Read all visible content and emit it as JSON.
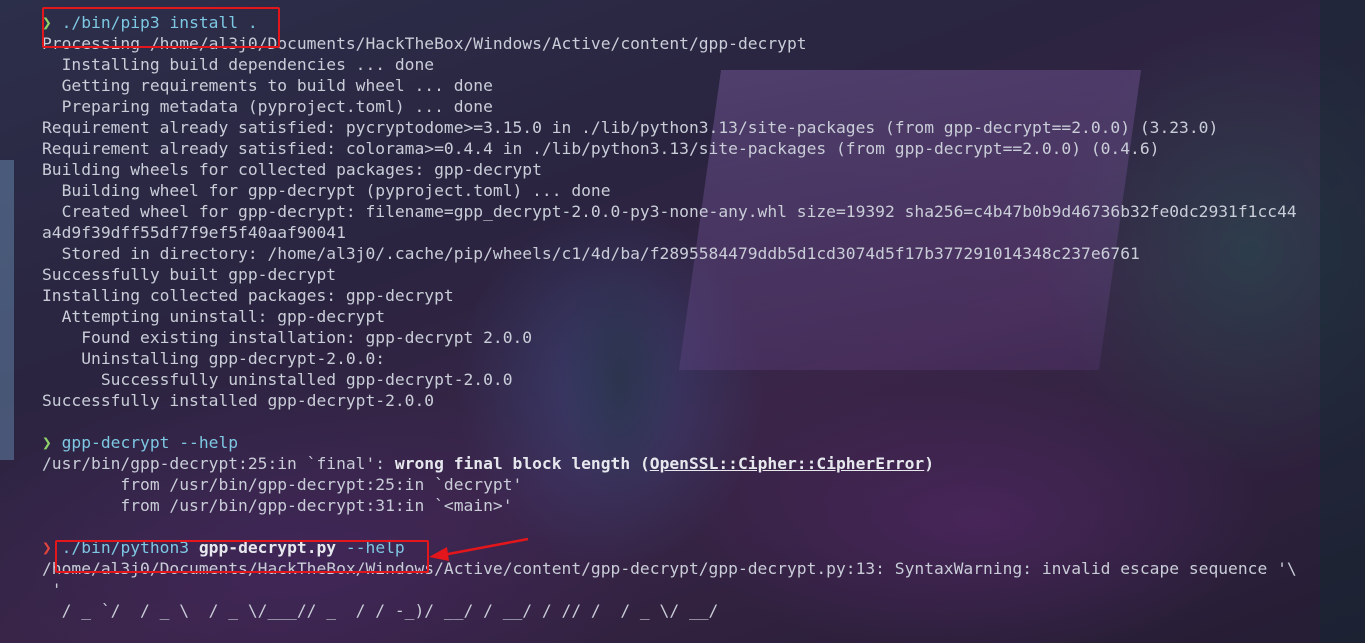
{
  "terminal": {
    "prompt_symbol": "❯",
    "lines": [
      {
        "kind": "prompt",
        "cmd": "./bin/pip3",
        "args": " install ."
      },
      {
        "kind": "text",
        "text": "Processing /home/al3j0/Documents/HackTheBox/Windows/Active/content/gpp-decrypt"
      },
      {
        "kind": "text",
        "text": "  Installing build dependencies ... done"
      },
      {
        "kind": "text",
        "text": "  Getting requirements to build wheel ... done"
      },
      {
        "kind": "text",
        "text": "  Preparing metadata (pyproject.toml) ... done"
      },
      {
        "kind": "text",
        "text": "Requirement already satisfied: pycryptodome>=3.15.0 in ./lib/python3.13/site-packages (from gpp-decrypt==2.0.0) (3.23.0)"
      },
      {
        "kind": "text",
        "text": "Requirement already satisfied: colorama>=0.4.4 in ./lib/python3.13/site-packages (from gpp-decrypt==2.0.0) (0.4.6)"
      },
      {
        "kind": "text",
        "text": "Building wheels for collected packages: gpp-decrypt"
      },
      {
        "kind": "text",
        "text": "  Building wheel for gpp-decrypt (pyproject.toml) ... done"
      },
      {
        "kind": "text",
        "text": "  Created wheel for gpp-decrypt: filename=gpp_decrypt-2.0.0-py3-none-any.whl size=19392 sha256=c4b47b0b9d46736b32fe0dc2931f1cc44"
      },
      {
        "kind": "text",
        "text": "a4d9f39dff55df7f9ef5f40aaf90041"
      },
      {
        "kind": "text",
        "text": "  Stored in directory: /home/al3j0/.cache/pip/wheels/c1/4d/ba/f2895584479ddb5d1cd3074d5f17b377291014348c237e6761"
      },
      {
        "kind": "text",
        "text": "Successfully built gpp-decrypt"
      },
      {
        "kind": "text",
        "text": "Installing collected packages: gpp-decrypt"
      },
      {
        "kind": "text",
        "text": "  Attempting uninstall: gpp-decrypt"
      },
      {
        "kind": "text",
        "text": "    Found existing installation: gpp-decrypt 2.0.0"
      },
      {
        "kind": "text",
        "text": "    Uninstalling gpp-decrypt-2.0.0:"
      },
      {
        "kind": "text",
        "text": "      Successfully uninstalled gpp-decrypt-2.0.0"
      },
      {
        "kind": "text",
        "text": "Successfully installed gpp-decrypt-2.0.0"
      },
      {
        "kind": "blank"
      },
      {
        "kind": "prompt",
        "cmd": "gpp-decrypt",
        "args": " --help"
      },
      {
        "kind": "error",
        "pre": "/usr/bin/gpp-decrypt:25:in `final': ",
        "bold": "wrong final block length",
        "mid": " (",
        "under": "OpenSSL::Cipher::CipherError",
        "post": ")"
      },
      {
        "kind": "text",
        "text": "        from /usr/bin/gpp-decrypt:25:in `decrypt'"
      },
      {
        "kind": "text",
        "text": "        from /usr/bin/gpp-decrypt:31:in `<main>'"
      },
      {
        "kind": "blank"
      },
      {
        "kind": "prompt-err",
        "cmd": "./bin/python3",
        "boldarg": " gpp-decrypt.py",
        "args": " --help"
      },
      {
        "kind": "text",
        "text": "/home/al3j0/Documents/HackTheBox/Windows/Active/content/gpp-decrypt/gpp-decrypt.py:13: SyntaxWarning: invalid escape sequence '\\"
      },
      {
        "kind": "text",
        "text": " '"
      },
      {
        "kind": "text",
        "text": "  / _ `/  / _ \\  / _ \\/___// _  / / -_)/ __/ / __/ / // /  / _ \\/ __/"
      }
    ]
  },
  "colors": {
    "prompt_ok": "#8fd36a",
    "prompt_err": "#e0443e",
    "command": "#7ec8e3",
    "text": "#c9cdd8",
    "highlight": "#e3161b"
  }
}
